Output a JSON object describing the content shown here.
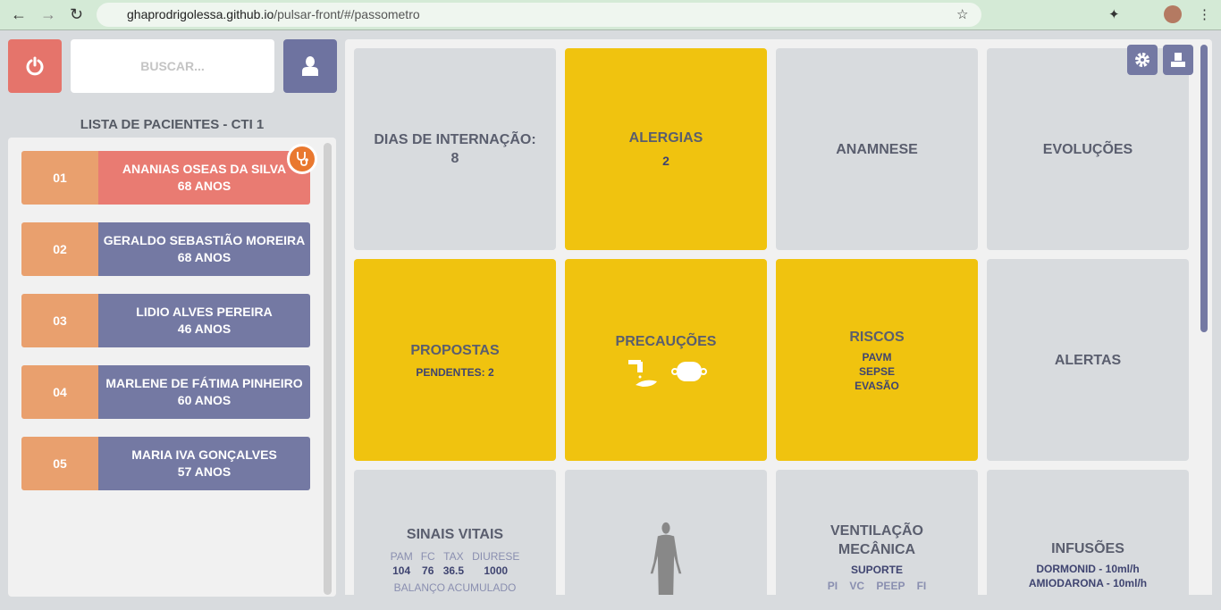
{
  "browser": {
    "url_host": "ghaprodrigolessa.github.io",
    "url_path": "/pulsar-front/#/passometro"
  },
  "toolbar": {
    "search_placeholder": "BUSCAR..."
  },
  "sidebar": {
    "title": "LISTA DE PACIENTES - CTI 1",
    "patients": [
      {
        "num": "01",
        "name": "ANANIAS OSEAS DA SILVA",
        "age": "68 ANOS",
        "active": true
      },
      {
        "num": "02",
        "name": "GERALDO SEBASTIÃO MOREIRA",
        "age": "68 ANOS"
      },
      {
        "num": "03",
        "name": "LIDIO ALVES PEREIRA",
        "age": "46 ANOS"
      },
      {
        "num": "04",
        "name": "MARLENE DE FÁTIMA PINHEIRO",
        "age": "60 ANOS"
      },
      {
        "num": "05",
        "name": "MARIA IVA GONÇALVES",
        "age": "57 ANOS"
      }
    ]
  },
  "cards": {
    "dias": {
      "title": "DIAS DE INTERNAÇÃO:",
      "value": "8"
    },
    "alergias": {
      "title": "ALERGIAS",
      "value": "2"
    },
    "anamnese": {
      "title": "ANAMNESE"
    },
    "evolucoes": {
      "title": "EVOLUÇÕES"
    },
    "propostas": {
      "title": "PROPOSTAS",
      "sub": "PENDENTES: 2"
    },
    "precaucoes": {
      "title": "PRECAUÇÕES"
    },
    "riscos": {
      "title": "RISCOS",
      "items": [
        "PAVM",
        "SEPSE",
        "EVASÃO"
      ]
    },
    "alertas": {
      "title": "ALERTAS"
    },
    "sinais": {
      "title": "SINAIS VITAIS",
      "labels": [
        "PAM",
        "FC",
        "TAX",
        "DIURESE"
      ],
      "values": [
        "104",
        "76",
        "36.5",
        "1000"
      ],
      "extra": "BALANÇO ACUMULADO"
    },
    "ventilacao": {
      "title": "VENTILAÇÃO MECÂNICA",
      "sub": "SUPORTE",
      "params": "PI    VC    PEEP    FI"
    },
    "infusoes": {
      "title": "INFUSÕES",
      "items": [
        "DORMONID - 10ml/h",
        "AMIODARONA - 10ml/h"
      ]
    }
  },
  "colors": {
    "accent": "#7479a3",
    "danger": "#e97b72",
    "number": "#e9a06e",
    "warning": "#f0c30f",
    "card": "#d8dbde"
  }
}
